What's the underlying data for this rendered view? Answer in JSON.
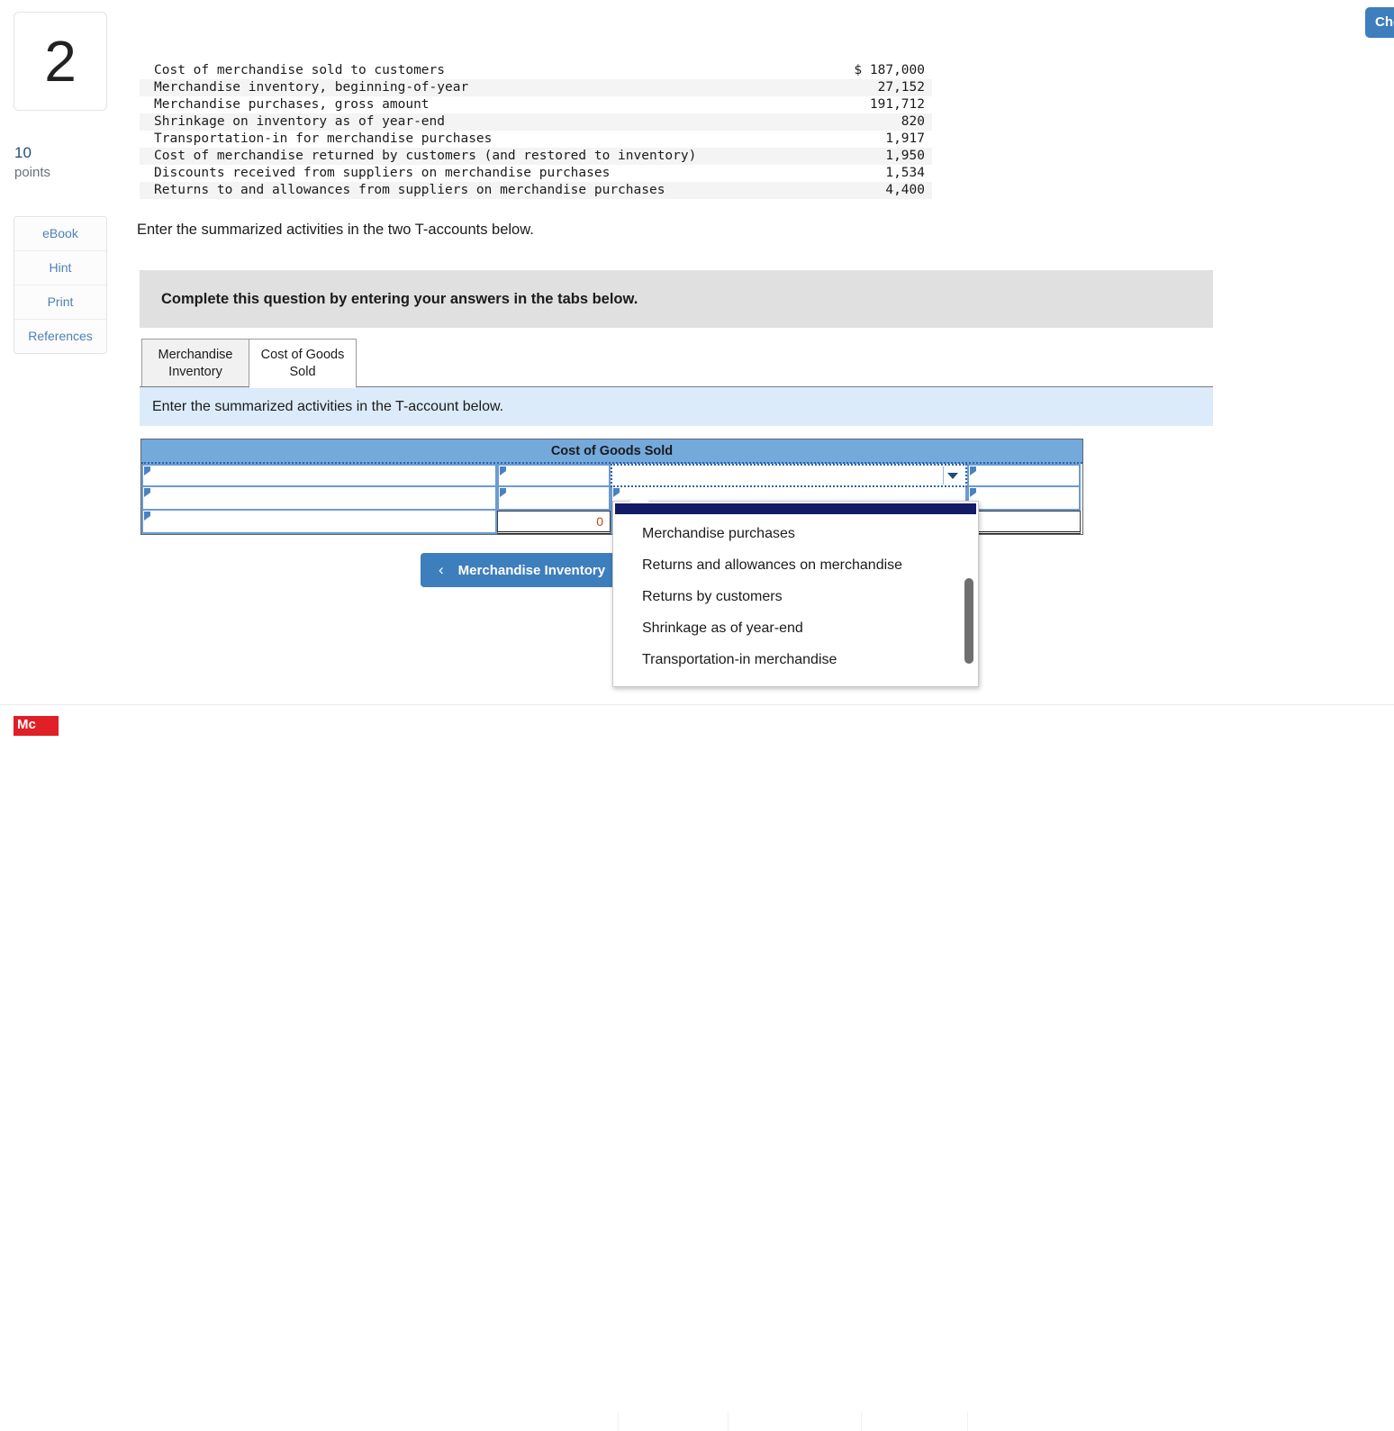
{
  "header": {
    "check_button_label": "Check my work"
  },
  "rail": {
    "question_number": "2",
    "points_value": "10",
    "points_label": "points",
    "buttons": [
      {
        "label": "eBook"
      },
      {
        "label": "Hint"
      },
      {
        "label": "Print"
      },
      {
        "label": "References"
      }
    ]
  },
  "fact_table": {
    "rows": [
      {
        "label": "Cost of merchandise sold to customers",
        "amount": "$ 187,000"
      },
      {
        "label": "Merchandise inventory, beginning-of-year",
        "amount": "27,152"
      },
      {
        "label": "Merchandise purchases, gross amount",
        "amount": "191,712"
      },
      {
        "label": "Shrinkage on inventory as of year-end",
        "amount": "820"
      },
      {
        "label": "Transportation-in for merchandise purchases",
        "amount": "1,917"
      },
      {
        "label": "Cost of merchandise returned by customers (and restored to inventory)",
        "amount": "1,950"
      },
      {
        "label": "Discounts received from suppliers on merchandise purchases",
        "amount": "1,534"
      },
      {
        "label": "Returns to and allowances from suppliers on merchandise purchases",
        "amount": "4,400"
      }
    ]
  },
  "prompt": "Enter the summarized activities in the two T-accounts below.",
  "banner": {
    "text": "Complete this question by entering your answers in the tabs below."
  },
  "tabs": [
    {
      "label": "Merchandise Inventory",
      "active": false
    },
    {
      "label": "Cost of Goods Sold",
      "active": true
    }
  ],
  "info_bar": {
    "text": "Enter the summarized activities in the T-account below."
  },
  "t_account": {
    "title": "Cost of Goods Sold",
    "rows": [
      {
        "left_desc": "",
        "left_amt": "",
        "right_desc": "",
        "right_amt": ""
      },
      {
        "left_desc": "",
        "left_amt": "",
        "right_desc": "",
        "right_amt": ""
      },
      {
        "left_desc": "",
        "left_amt": "0",
        "right_desc": "",
        "right_amt": ""
      }
    ]
  },
  "nav_button": {
    "chevron": "‹",
    "label": "Merchandise Inventory"
  },
  "dropdown": {
    "options": [
      "Merchandise purchases",
      "Returns and allowances on merchandise",
      "Returns by customers",
      "Shrinkage as of year-end",
      "Transportation-in merchandise"
    ]
  },
  "footer": {
    "logo_text": "Mc"
  },
  "colors": {
    "accent_blue": "#3d7ebd",
    "taccount_header": "#74a9dc",
    "info_bar": "#dbebfa",
    "banner_grey": "#e0e0e0",
    "dropdown_highlight": "#131a66",
    "logo_red": "#e01f26"
  }
}
